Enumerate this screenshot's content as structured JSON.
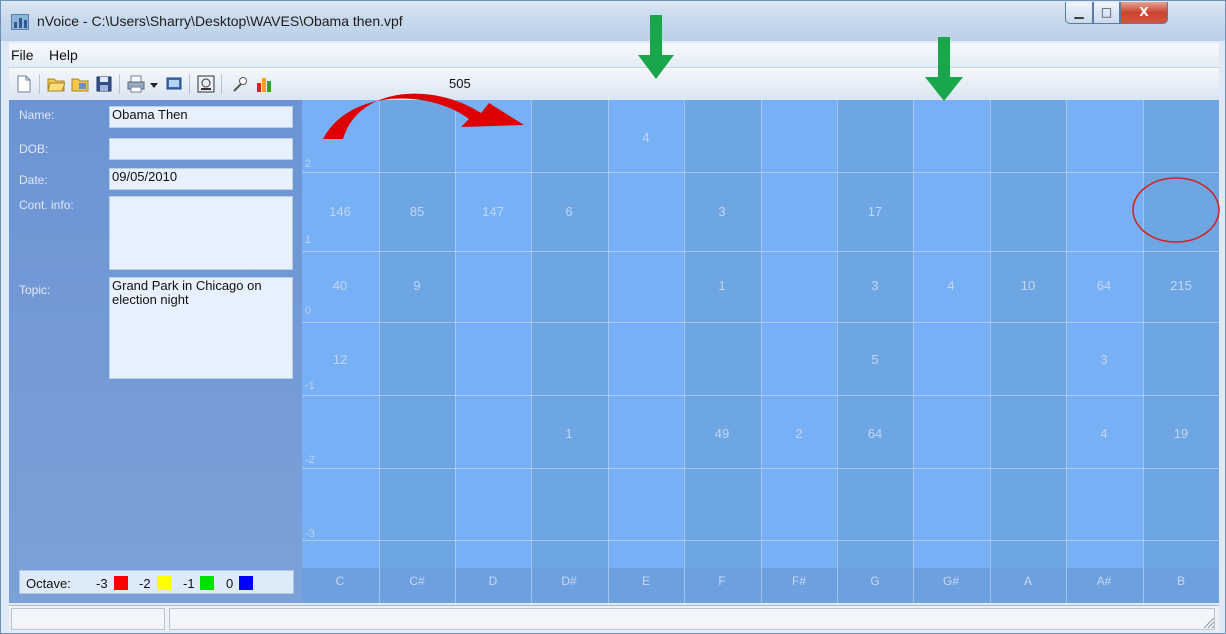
{
  "window": {
    "title": "nVoice - C:\\Users\\Sharry\\Desktop\\WAVES\\Obama then.vpf",
    "minimize_glyph": "▁",
    "maximize_glyph": "□",
    "close_glyph": "X"
  },
  "menu": [
    "File",
    "Help"
  ],
  "toolbar": {
    "icons": [
      "new-file-icon",
      "open-folder-icon",
      "open-recent-icon",
      "save-icon",
      "print-icon",
      "dropdown-arrow-icon",
      "monitor-icon",
      "record-settings-icon",
      "microphone-icon",
      "chart-icon"
    ],
    "count": "505"
  },
  "profile": {
    "name_label": "Name:",
    "name_value": "Obama Then",
    "dob_label": "DOB:",
    "dob_value": "",
    "date_label": "Date:",
    "date_value": "09/05/2010",
    "contact_label": "Cont. info:",
    "contact_value": "",
    "topic_label": "Topic:",
    "topic_value": "Grand Park in Chicago on election night"
  },
  "octave_legend": {
    "label": "Octave:",
    "items": [
      {
        "label": "-3",
        "color": "#ff0000"
      },
      {
        "label": "-2",
        "color": "#ffff00"
      },
      {
        "label": "-1",
        "color": "#00e000"
      },
      {
        "label": "0",
        "color": "#0000ff"
      }
    ]
  },
  "grid": {
    "notes": [
      "C",
      "C#",
      "D",
      "D#",
      "E",
      "F",
      "F#",
      "G",
      "G#",
      "A",
      "A#",
      "B"
    ],
    "row_labels": [
      "2",
      "1",
      "0",
      "-1",
      "-2",
      "-3"
    ],
    "rows": [
      [
        "",
        "",
        "",
        "",
        "4",
        "",
        "",
        "",
        "",
        "",
        "",
        ""
      ],
      [
        "146",
        "85",
        "147",
        "6",
        "",
        "3",
        "",
        "17",
        "",
        "",
        "",
        ""
      ],
      [
        "40",
        "9",
        "",
        "",
        "",
        "1",
        "",
        "3",
        "4",
        "10",
        "64",
        "215"
      ],
      [
        "12",
        "",
        "",
        "",
        "",
        "",
        "",
        "5",
        "",
        "",
        "3",
        ""
      ],
      [
        "",
        "",
        "",
        "1",
        "",
        "49",
        "2",
        "64",
        "",
        "",
        "4",
        "19"
      ],
      [
        "",
        "",
        "",
        "",
        "",
        "",
        "",
        "",
        "",
        "",
        "",
        ""
      ]
    ]
  },
  "annotations": {
    "arrow_color_green": "#1aa64a",
    "arrow_color_red": "#dd0000",
    "circle_color": "#d42020"
  },
  "status": {
    "pane1": "",
    "pane2": ""
  }
}
